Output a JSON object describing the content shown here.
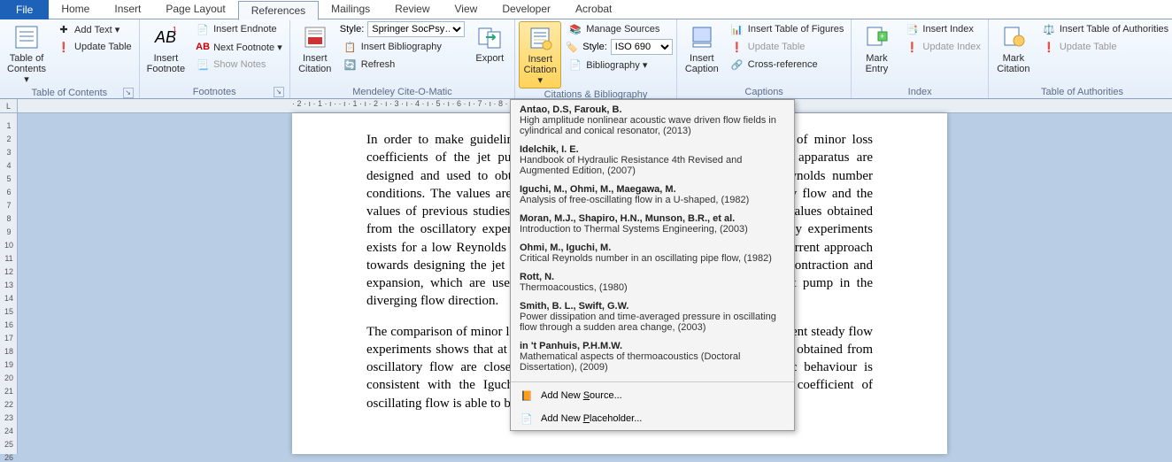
{
  "tabs": {
    "file": "File",
    "items": [
      "Home",
      "Insert",
      "Page Layout",
      "References",
      "Mailings",
      "Review",
      "View",
      "Developer",
      "Acrobat"
    ],
    "active": "References"
  },
  "ribbon": {
    "toc": {
      "big": "Table of\nContents ▾",
      "addText": "Add Text ▾",
      "updateTable": "Update Table",
      "label": "Table of Contents"
    },
    "footnotes": {
      "big": "Insert\nFootnote",
      "insertEndnote": "Insert Endnote",
      "nextFootnote": "Next Footnote ▾",
      "showNotes": "Show Notes",
      "label": "Footnotes"
    },
    "mendeley": {
      "bigCitation": "Insert\nCitation",
      "styleLabel": "Style:",
      "styleValue": "Springer SocPsy…",
      "insertBib": "Insert Bibliography",
      "refresh": "Refresh",
      "export": "Export",
      "label": "Mendeley Cite-O-Matic"
    },
    "citations": {
      "bigInsert": "Insert\nCitation ▾",
      "manageSources": "Manage Sources",
      "styleLabel": "Style:",
      "styleValue": "ISO 690",
      "bibliography": "Bibliography ▾",
      "label": "Citations & Bibliography"
    },
    "captions": {
      "big": "Insert\nCaption",
      "insertTOF": "Insert Table of Figures",
      "updateTable": "Update Table",
      "crossRef": "Cross-reference",
      "label": "Captions"
    },
    "index": {
      "big": "Mark\nEntry",
      "insertIndex": "Insert Index",
      "updateIndex": "Update Index",
      "label": "Index"
    },
    "toa": {
      "big": "Mark\nCitation",
      "insertTOA": "Insert Table of Authorities",
      "updateTable": "Update Table",
      "label": "Table of Authorities"
    }
  },
  "ruler": {
    "corner": "L",
    "hmarks": "· 2 · ı · 1 · ı ·   · ı · 1 · ı · 2 · ı · 3 · ı · 4 · ı · 5 · ı · 6 · ı · 7 · ı · 8 · ı · 9 · ı · 10 · ı · 11 · ı · 12 · ı · 13 · ı · 14 · ı · 15 · ı · 16 · ı · 17 · ı · 18 · ı"
  },
  "document": {
    "p1": "In order to make guidelines for designing a fluidic diode, an investigation of minor loss coefficients of the jet pump is required. A computational experiment and apparatus are designed and used to obtain the minor loss coefficients under various Reynolds number conditions. The values are compared with the results of experiment in steady flow and the values of previous studies. It was found that a large deviation between the values obtained from the oscillatory experiments and the coefficient obtained from the steady experiments exists for a low Reynolds number. The result leads to a conclusion that the current approach towards designing the jet pump cannot work for estimating minor losses of contraction and expansion, which are used to measure the asymmetry performance of a jet pump in the diverging flow direction.",
    "p2": "The comparison of minor loss coefficients between oscillating flow and equivalent steady flow experiments shows that at a high Reynolds number the minor loss coefficients obtained from oscillatory flow are close to the values for steady flow. This characteristic behaviour is consistent with the Iguchi hypothesis which implies that the minor loss coefficient of oscillating flow is able to be estimated by the coefficient of steady flow."
  },
  "popup": {
    "citations": [
      {
        "authors": "Antao, D.S,  Farouk, B.",
        "title": "High amplitude nonlinear acoustic wave driven flow fields in cylindrical and conical resonator, (2013)"
      },
      {
        "authors": "Idelchik, I. E.",
        "title": "Handbook of Hydraulic Resistance 4th Revised and Augmented Edition, (2007)"
      },
      {
        "authors": "Iguchi, M., Ohmi, M., Maegawa, M.",
        "title": "Analysis of free-oscillating flow in a U-shaped, (1982)"
      },
      {
        "authors": "Moran, M.J., Shapiro, H.N., Munson, B.R., et al.",
        "title": "Introduction to Thermal Systems Engineering, (2003)"
      },
      {
        "authors": "Ohmi, M.,  Iguchi, M.",
        "title": "Critical Reynolds number in an oscillating pipe flow, (1982)"
      },
      {
        "authors": "Rott, N.",
        "title": "Thermoacoustics, (1980)"
      },
      {
        "authors": "Smith, B. L., Swift, G.W.",
        "title": "Power dissipation and time-averaged pressure in oscillating flow through a sudden area change, (2003)"
      },
      {
        "authors": "in 't Panhuis, P.H.M.W.",
        "title": "Mathematical aspects of thermoacoustics (Doctoral Dissertation), (2009)"
      }
    ],
    "addSourcePrefix": "Add New ",
    "addSourceUL": "S",
    "addSourceSuffix": "ource...",
    "addPlaceholderPrefix": "Add New ",
    "addPlaceholderUL": "P",
    "addPlaceholderSuffix": "laceholder..."
  }
}
